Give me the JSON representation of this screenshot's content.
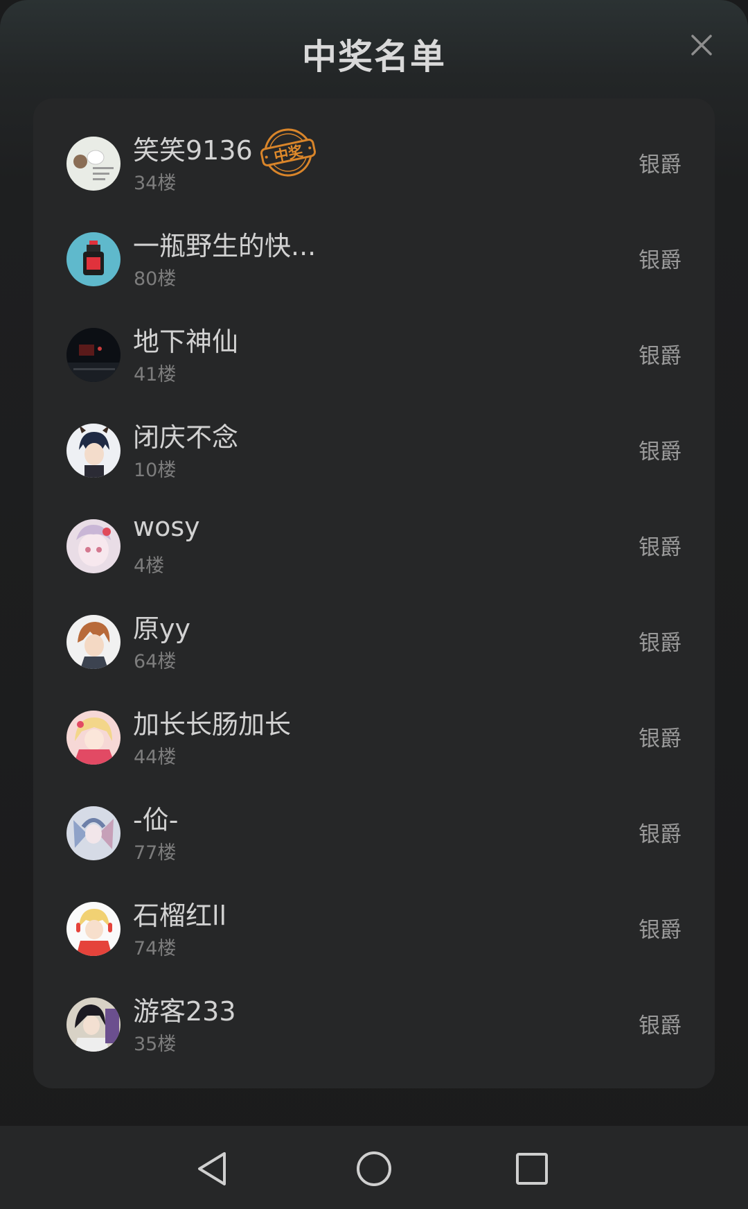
{
  "dialog": {
    "title": "中奖名单",
    "close_icon": "close-icon"
  },
  "winner_badge": "中奖",
  "winners": [
    {
      "name": "笑笑9136",
      "floor": "34楼",
      "prize": "银爵",
      "highlight": true
    },
    {
      "name": "一瓶野生的快...",
      "floor": "80楼",
      "prize": "银爵"
    },
    {
      "name": "地下神仙",
      "floor": "41楼",
      "prize": "银爵"
    },
    {
      "name": "闭庆不念",
      "floor": "10楼",
      "prize": "银爵"
    },
    {
      "name": "wosy",
      "floor": "4楼",
      "prize": "银爵"
    },
    {
      "name": "原yy",
      "floor": "64楼",
      "prize": "银爵"
    },
    {
      "name": "加长长肠加长",
      "floor": "44楼",
      "prize": "银爵"
    },
    {
      "name": "-佡-",
      "floor": "77楼",
      "prize": "银爵"
    },
    {
      "name": "石榴红ll",
      "floor": "74楼",
      "prize": "银爵"
    },
    {
      "name": "游客233",
      "floor": "35楼",
      "prize": "银爵"
    }
  ],
  "navbar": {
    "back_icon": "back-triangle-icon",
    "home_icon": "home-circle-icon",
    "recents_icon": "recents-square-icon"
  },
  "colors": {
    "badge": "#e08a2b",
    "card": "#262728",
    "text": "#d2d2d2"
  }
}
